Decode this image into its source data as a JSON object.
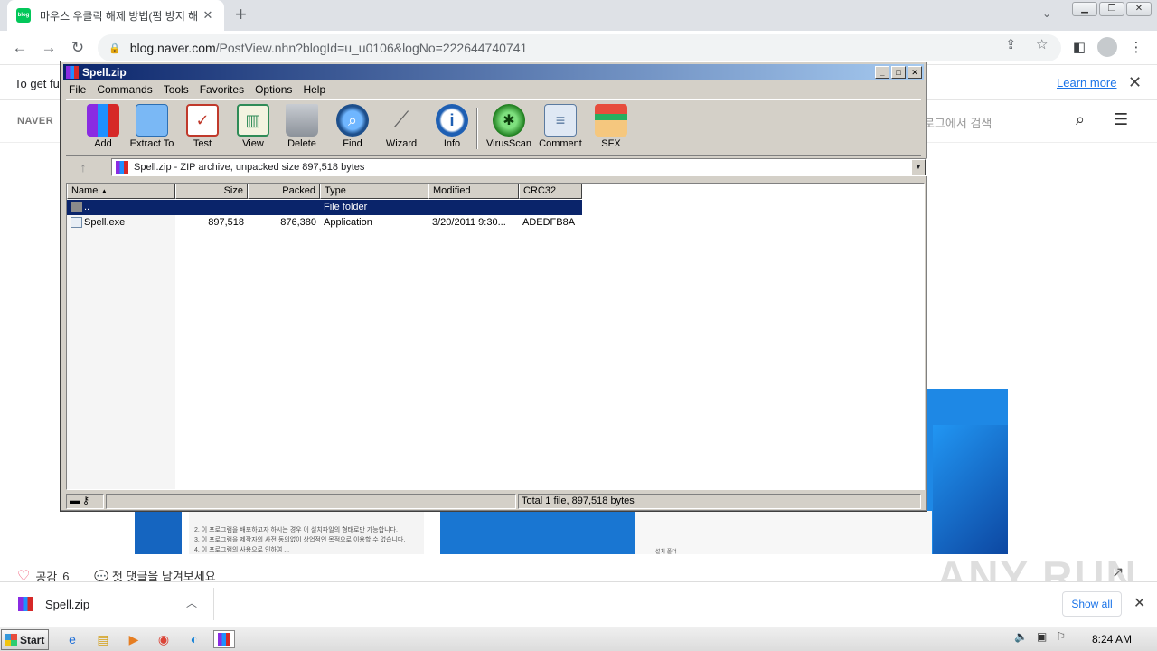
{
  "browser": {
    "tab_title": "마우스 우클릭 해제 방법(펌 방지 해",
    "tab_favicon_text": "blog",
    "url_domain": "blog.naver.com",
    "url_path": "/PostView.nhn?blogId=u_u0106&logNo=222644740741"
  },
  "page": {
    "cookie_text": "To get fu",
    "learn_more": "Learn more",
    "naver_logo": "NAVER",
    "search_placeholder": "로그에서 검색",
    "likes_label": "공감",
    "likes_count": "6",
    "comment_prompt": "첫 댓글을 남겨보세요",
    "doc_line1": "2. 이 프로그램을 배포하고자 하시는 경우 이 설치파일의 형태로만 가능합니다.",
    "doc_line2": "3. 이 프로그램을 제작자의 사전 동의없이 상업적인 목적으로 이용할 수 없습니다.",
    "doc_line3": "4. 이 프로그램의 사용으로 인하여 ...",
    "tiny_label": "설치 폴더",
    "watermark": "ANY RUN"
  },
  "downloads": {
    "file": "Spell.zip",
    "show_all": "Show all"
  },
  "taskbar": {
    "start": "Start",
    "time": "8:24 AM"
  },
  "winrar": {
    "title": "Spell.zip",
    "menu": [
      "File",
      "Commands",
      "Tools",
      "Favorites",
      "Options",
      "Help"
    ],
    "tools": [
      "Add",
      "Extract To",
      "Test",
      "View",
      "Delete",
      "Find",
      "Wizard",
      "Info",
      "VirusScan",
      "Comment",
      "SFX"
    ],
    "address": "Spell.zip - ZIP archive, unpacked size 897,518 bytes",
    "columns": [
      "Name",
      "Size",
      "Packed",
      "Type",
      "Modified",
      "CRC32"
    ],
    "rows": [
      {
        "name": "..",
        "size": "",
        "packed": "",
        "type": "File folder",
        "modified": "",
        "crc": ""
      },
      {
        "name": "Spell.exe",
        "size": "897,518",
        "packed": "876,380",
        "type": "Application",
        "modified": "3/20/2011 9:30...",
        "crc": "ADEDFB8A"
      }
    ],
    "status": "Total 1 file, 897,518 bytes"
  },
  "colors": {
    "title_bar": "#0a246a",
    "selection": "#0a246a",
    "link": "#1a73e8"
  }
}
